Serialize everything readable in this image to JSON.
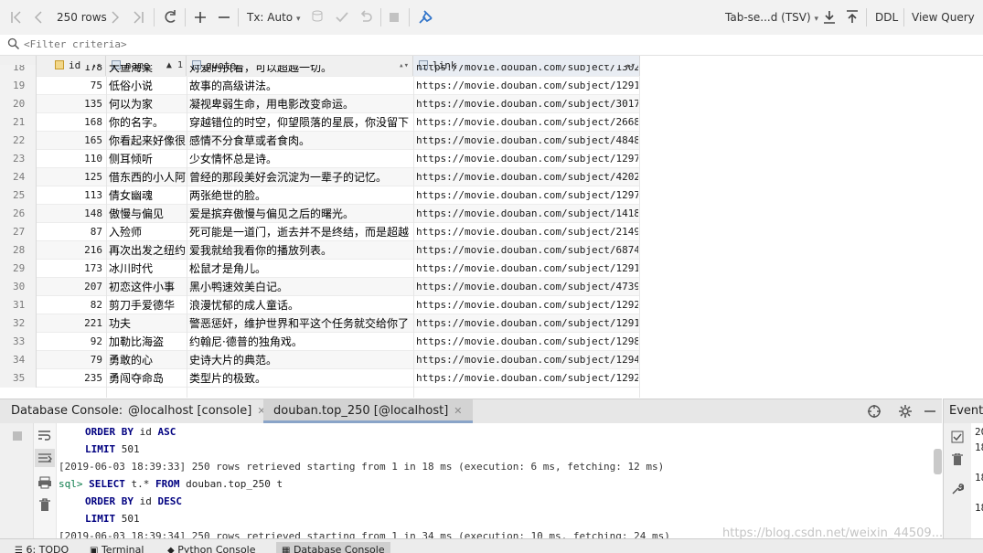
{
  "toolbar": {
    "rows_label": "250 rows",
    "tx_label": "Tx: Auto",
    "format_label": "Tab-se...d (TSV)",
    "ddl_label": "DDL",
    "view_query_label": "View Query"
  },
  "filter": {
    "placeholder": "<Filter criteria>"
  },
  "grid": {
    "columns": [
      {
        "label": "id"
      },
      {
        "label": "name",
        "sort_order": "1"
      },
      {
        "label": "quote"
      },
      {
        "label": "link"
      }
    ],
    "partial_row": {
      "num": "18",
      "id": "178",
      "name": "大鱼海棠",
      "quote": "对爱的执着，可以超越一切。",
      "link": "https://movie.douban.com/subject/1302"
    },
    "rows": [
      {
        "num": "19",
        "id": "75",
        "name": "低俗小说",
        "quote": "故事的高级讲法。",
        "link": "https://movie.douban.com/subject/1291…"
      },
      {
        "num": "20",
        "id": "135",
        "name": "何以为家",
        "quote": "凝视卑弱生命，用电影改变命运。",
        "link": "https://movie.douban.com/subject/3017…"
      },
      {
        "num": "21",
        "id": "168",
        "name": "你的名字。",
        "quote": "穿越错位的时空，仰望陨落的星辰，你没留下",
        "link": "https://movie.douban.com/subject/2668…"
      },
      {
        "num": "22",
        "id": "165",
        "name": "你看起来好像很",
        "quote": "感情不分食草或者食肉。",
        "link": "https://movie.douban.com/subject/4848…"
      },
      {
        "num": "23",
        "id": "110",
        "name": "侧耳倾听",
        "quote": "少女情怀总是诗。",
        "link": "https://movie.douban.com/subject/1297…"
      },
      {
        "num": "24",
        "id": "125",
        "name": "借东西的小人阿",
        "quote": "曾经的那段美好会沉淀为一辈子的记忆。",
        "link": "https://movie.douban.com/subject/4202…"
      },
      {
        "num": "25",
        "id": "113",
        "name": "倩女幽魂",
        "quote": "两张绝世的脸。",
        "link": "https://movie.douban.com/subject/1297…"
      },
      {
        "num": "26",
        "id": "148",
        "name": "傲慢与偏见",
        "quote": "爱是摈弃傲慢与偏见之后的曙光。",
        "link": "https://movie.douban.com/subject/1418…"
      },
      {
        "num": "27",
        "id": "87",
        "name": "入殓师",
        "quote": "死可能是一道门，逝去并不是终结，而是超越",
        "link": "https://movie.douban.com/subject/2149…"
      },
      {
        "num": "28",
        "id": "216",
        "name": "再次出发之纽约",
        "quote": "爱我就给我看你的播放列表。",
        "link": "https://movie.douban.com/subject/6874…"
      },
      {
        "num": "29",
        "id": "173",
        "name": "冰川时代",
        "quote": "松鼠才是角儿。",
        "link": "https://movie.douban.com/subject/1291…"
      },
      {
        "num": "30",
        "id": "207",
        "name": "初恋这件小事",
        "quote": "黑小鸭速效美白记。",
        "link": "https://movie.douban.com/subject/4739…"
      },
      {
        "num": "31",
        "id": "82",
        "name": "剪刀手爱德华",
        "quote": "浪漫忧郁的成人童话。",
        "link": "https://movie.douban.com/subject/1292…"
      },
      {
        "num": "32",
        "id": "221",
        "name": "功夫",
        "quote": "警恶惩奸，维护世界和平这个任务就交给你了",
        "link": "https://movie.douban.com/subject/1291…"
      },
      {
        "num": "33",
        "id": "92",
        "name": "加勒比海盗",
        "quote": "约翰尼·德普的独角戏。",
        "link": "https://movie.douban.com/subject/1298…"
      },
      {
        "num": "34",
        "id": "79",
        "name": "勇敢的心",
        "quote": "史诗大片的典范。",
        "link": "https://movie.douban.com/subject/1294…"
      },
      {
        "num": "35",
        "id": "235",
        "name": "勇闯夺命岛",
        "quote": "类型片的极致。",
        "link": "https://movie.douban.com/subject/1292…"
      }
    ]
  },
  "console": {
    "prefix_label": "Database Console:",
    "tabs": [
      {
        "label": "@localhost [console]"
      },
      {
        "label": "douban.top_250 [@localhost]"
      }
    ],
    "event_label": "Event L",
    "lines": {
      "l1_kw": "ORDER BY",
      "l1_rest": " id ",
      "l1_kw2": "ASC",
      "l2_kw": "LIMIT",
      "l2_rest": " 501",
      "l3": "[2019-06-03 18:39:33] 250 rows retrieved starting from 1 in 18 ms (execution: 6 ms, fetching: 12 ms)",
      "l4_pfx": "sql>",
      "l4_kw": "SELECT",
      "l4_mid": " t.* ",
      "l4_kw2": "FROM",
      "l4_rest": " douban.top_250 t",
      "l5_kw": "ORDER BY",
      "l5_rest": " id ",
      "l5_kw2": "DESC",
      "l6_kw": "LIMIT",
      "l6_rest": " 501",
      "l7": "[2019-06-03 18:39:34] 250 rows retrieved starting from 1 in 34 ms (execution: 10 ms, fetching: 24 ms)"
    },
    "event_lines": [
      "20",
      "18",
      "18",
      "18"
    ]
  },
  "bottom_tabs": [
    {
      "label": "6: TODO"
    },
    {
      "label": "Terminal"
    },
    {
      "label": "Python Console"
    },
    {
      "label": "Database Console"
    }
  ],
  "watermark": "https://blog.csdn.net/weixin_44509..."
}
